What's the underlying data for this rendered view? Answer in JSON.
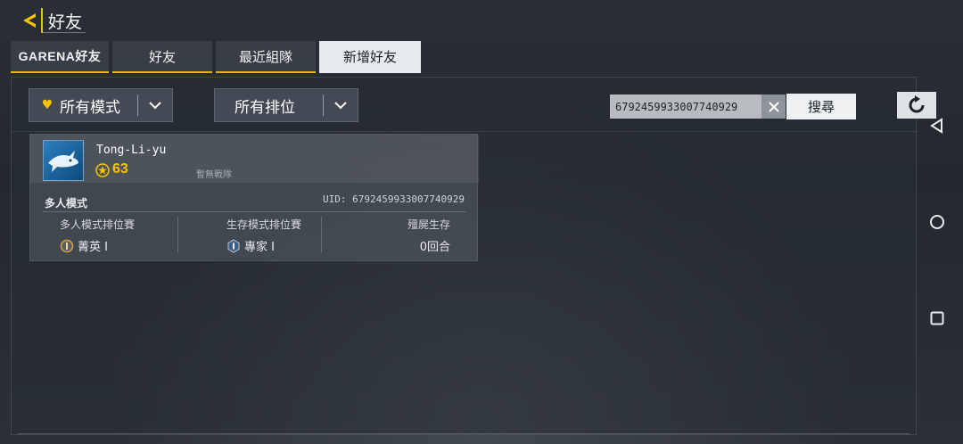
{
  "header": {
    "title": "好友"
  },
  "tabs": [
    {
      "label": "GARENA好友",
      "active": false
    },
    {
      "label": "好友",
      "active": false
    },
    {
      "label": "最近組隊",
      "active": false
    },
    {
      "label": "新增好友",
      "active": true
    }
  ],
  "filters": {
    "mode": {
      "label": "所有模式",
      "icon": "heart-icon"
    },
    "rank": {
      "label": "所有排位"
    }
  },
  "search": {
    "value": "6792459933007740929",
    "button_label": "搜尋"
  },
  "player_card": {
    "name": "Tong-Li-yu",
    "level": "63",
    "team_status": "暫無戰隊",
    "mode_label": "多人模式",
    "uid": "UID: 6792459933007740929",
    "ranks": [
      {
        "title": "多人模式排位賽",
        "value": "菁英 I",
        "icon": "elite-rank-icon"
      },
      {
        "title": "生存模式排位賽",
        "value": "專家 I",
        "icon": "expert-rank-icon"
      },
      {
        "title": "殭屍生存",
        "value": "0回合"
      }
    ]
  },
  "colors": {
    "accent": "#f5c400",
    "active_tab_bg": "#e9ecef",
    "panel_bg": "#282d34"
  }
}
